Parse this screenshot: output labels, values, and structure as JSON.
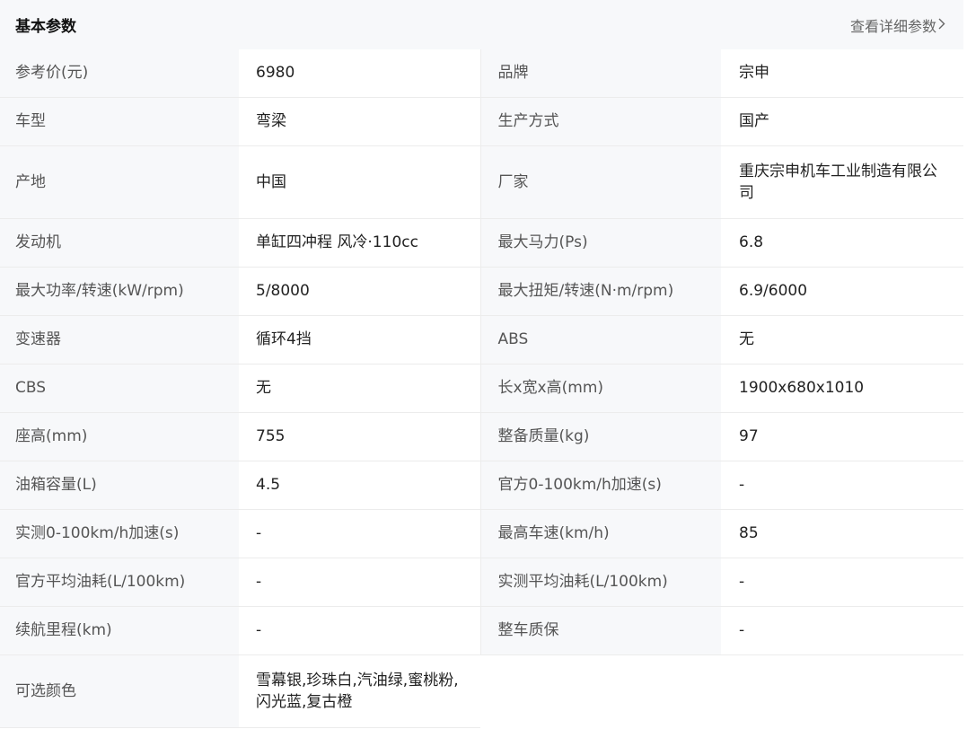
{
  "header": {
    "title": "基本参数",
    "detail_link": "查看详细参数",
    "chevron_icon": "chevron-right-icon"
  },
  "rows": [
    {
      "l1": "参考价(元)",
      "v1": "6980",
      "l2": "品牌",
      "v2": "宗申"
    },
    {
      "l1": "车型",
      "v1": "弯梁",
      "l2": "生产方式",
      "v2": "国产"
    },
    {
      "l1": "产地",
      "v1": "中国",
      "l2": "厂家",
      "v2": "重庆宗申机车工业制造有限公司"
    },
    {
      "l1": "发动机",
      "v1": "单缸四冲程 风冷·110cc",
      "l2": "最大马力(Ps)",
      "v2": "6.8"
    },
    {
      "l1": "最大功率/转速(kW/rpm)",
      "v1": "5/8000",
      "l2": "最大扭矩/转速(N·m/rpm)",
      "v2": "6.9/6000"
    },
    {
      "l1": "变速器",
      "v1": "循环4挡",
      "l2": "ABS",
      "v2": "无"
    },
    {
      "l1": "CBS",
      "v1": "无",
      "l2": "长x宽x高(mm)",
      "v2": "1900x680x1010"
    },
    {
      "l1": "座高(mm)",
      "v1": "755",
      "l2": "整备质量(kg)",
      "v2": "97"
    },
    {
      "l1": "油箱容量(L)",
      "v1": "4.5",
      "l2": "官方0-100km/h加速(s)",
      "v2": "-"
    },
    {
      "l1": "实测0-100km/h加速(s)",
      "v1": "-",
      "l2": "最高车速(km/h)",
      "v2": "85"
    },
    {
      "l1": "官方平均油耗(L/100km)",
      "v1": "-",
      "l2": "实测平均油耗(L/100km)",
      "v2": "-"
    },
    {
      "l1": "续航里程(km)",
      "v1": "-",
      "l2": "整车质保",
      "v2": "-"
    },
    {
      "l1": "可选颜色",
      "v1": "雪幕银,珍珠白,汽油绿,蜜桃粉,闪光蓝,复古橙"
    }
  ]
}
